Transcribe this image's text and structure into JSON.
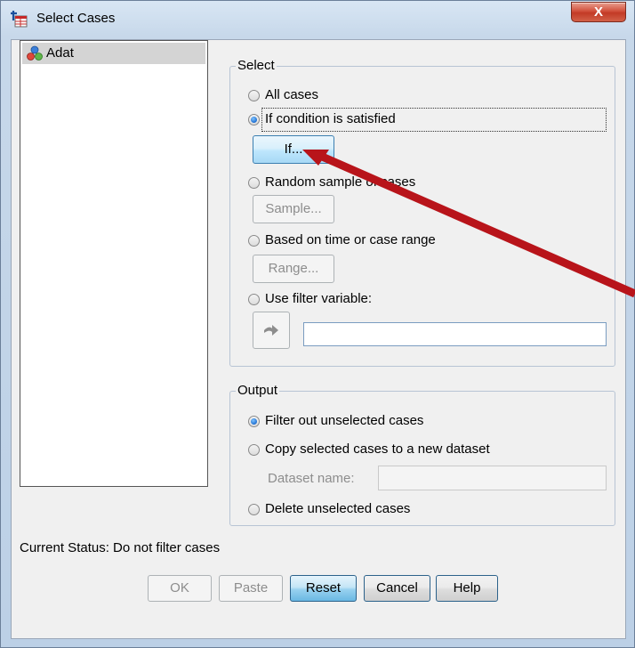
{
  "window": {
    "title": "Select Cases",
    "close_glyph": "X"
  },
  "variables": [
    {
      "label": "Adat",
      "icon": "nominal-variable-icon"
    }
  ],
  "select_group": {
    "legend": "Select",
    "options": [
      {
        "label": "All cases",
        "checked": false
      },
      {
        "label": "If condition is satisfied",
        "checked": true
      },
      {
        "label": "Random sample of cases",
        "checked": false
      },
      {
        "label": "Based on time or case range",
        "checked": false
      },
      {
        "label": "Use filter variable:",
        "checked": false
      }
    ],
    "if_button": "If...",
    "sample_button": "Sample...",
    "range_button": "Range...",
    "move_arrow_icon": "right-arrow-icon",
    "filter_variable_value": ""
  },
  "output_group": {
    "legend": "Output",
    "options": [
      {
        "label": "Filter out unselected cases",
        "checked": true
      },
      {
        "label": "Copy selected cases to a new dataset",
        "checked": false
      },
      {
        "label": "Delete unselected cases",
        "checked": false
      }
    ],
    "dataset_name_label": "Dataset name:",
    "dataset_name_value": ""
  },
  "status": {
    "text": "Current Status: Do not filter cases"
  },
  "footer": {
    "ok": "OK",
    "paste": "Paste",
    "reset": "Reset",
    "cancel": "Cancel",
    "help": "Help"
  },
  "annotation": {
    "arrow_color": "#b8141a"
  }
}
